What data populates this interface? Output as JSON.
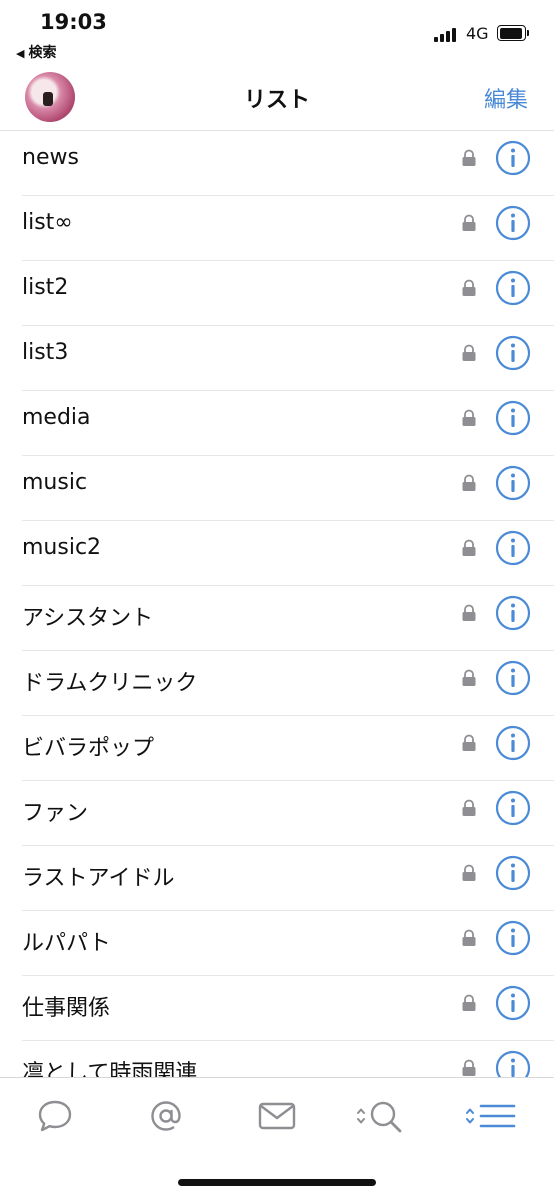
{
  "status_bar": {
    "time": "19:03",
    "back_label": "検索",
    "network": "4G"
  },
  "nav": {
    "title": "リスト",
    "edit_label": "編集"
  },
  "lists": [
    {
      "name": "news"
    },
    {
      "name": "list∞"
    },
    {
      "name": "list2"
    },
    {
      "name": "list3"
    },
    {
      "name": "media"
    },
    {
      "name": "music"
    },
    {
      "name": "music2"
    },
    {
      "name": "アシスタント"
    },
    {
      "name": "ドラムクリニック"
    },
    {
      "name": "ビバラポップ"
    },
    {
      "name": "ファン"
    },
    {
      "name": "ラストアイドル"
    },
    {
      "name": "ルパパト"
    },
    {
      "name": "仕事関係"
    },
    {
      "name": "凛として時雨関連"
    }
  ],
  "tabs": [
    {
      "icon": "chat-bubble-icon"
    },
    {
      "icon": "at-sign-icon"
    },
    {
      "icon": "envelope-icon"
    },
    {
      "icon": "search-icon"
    },
    {
      "icon": "list-icon",
      "selected": true
    }
  ],
  "colors": {
    "accent": "#4a8ad6",
    "inactive_icon": "#8e8e93",
    "lock": "#8e8e93"
  }
}
